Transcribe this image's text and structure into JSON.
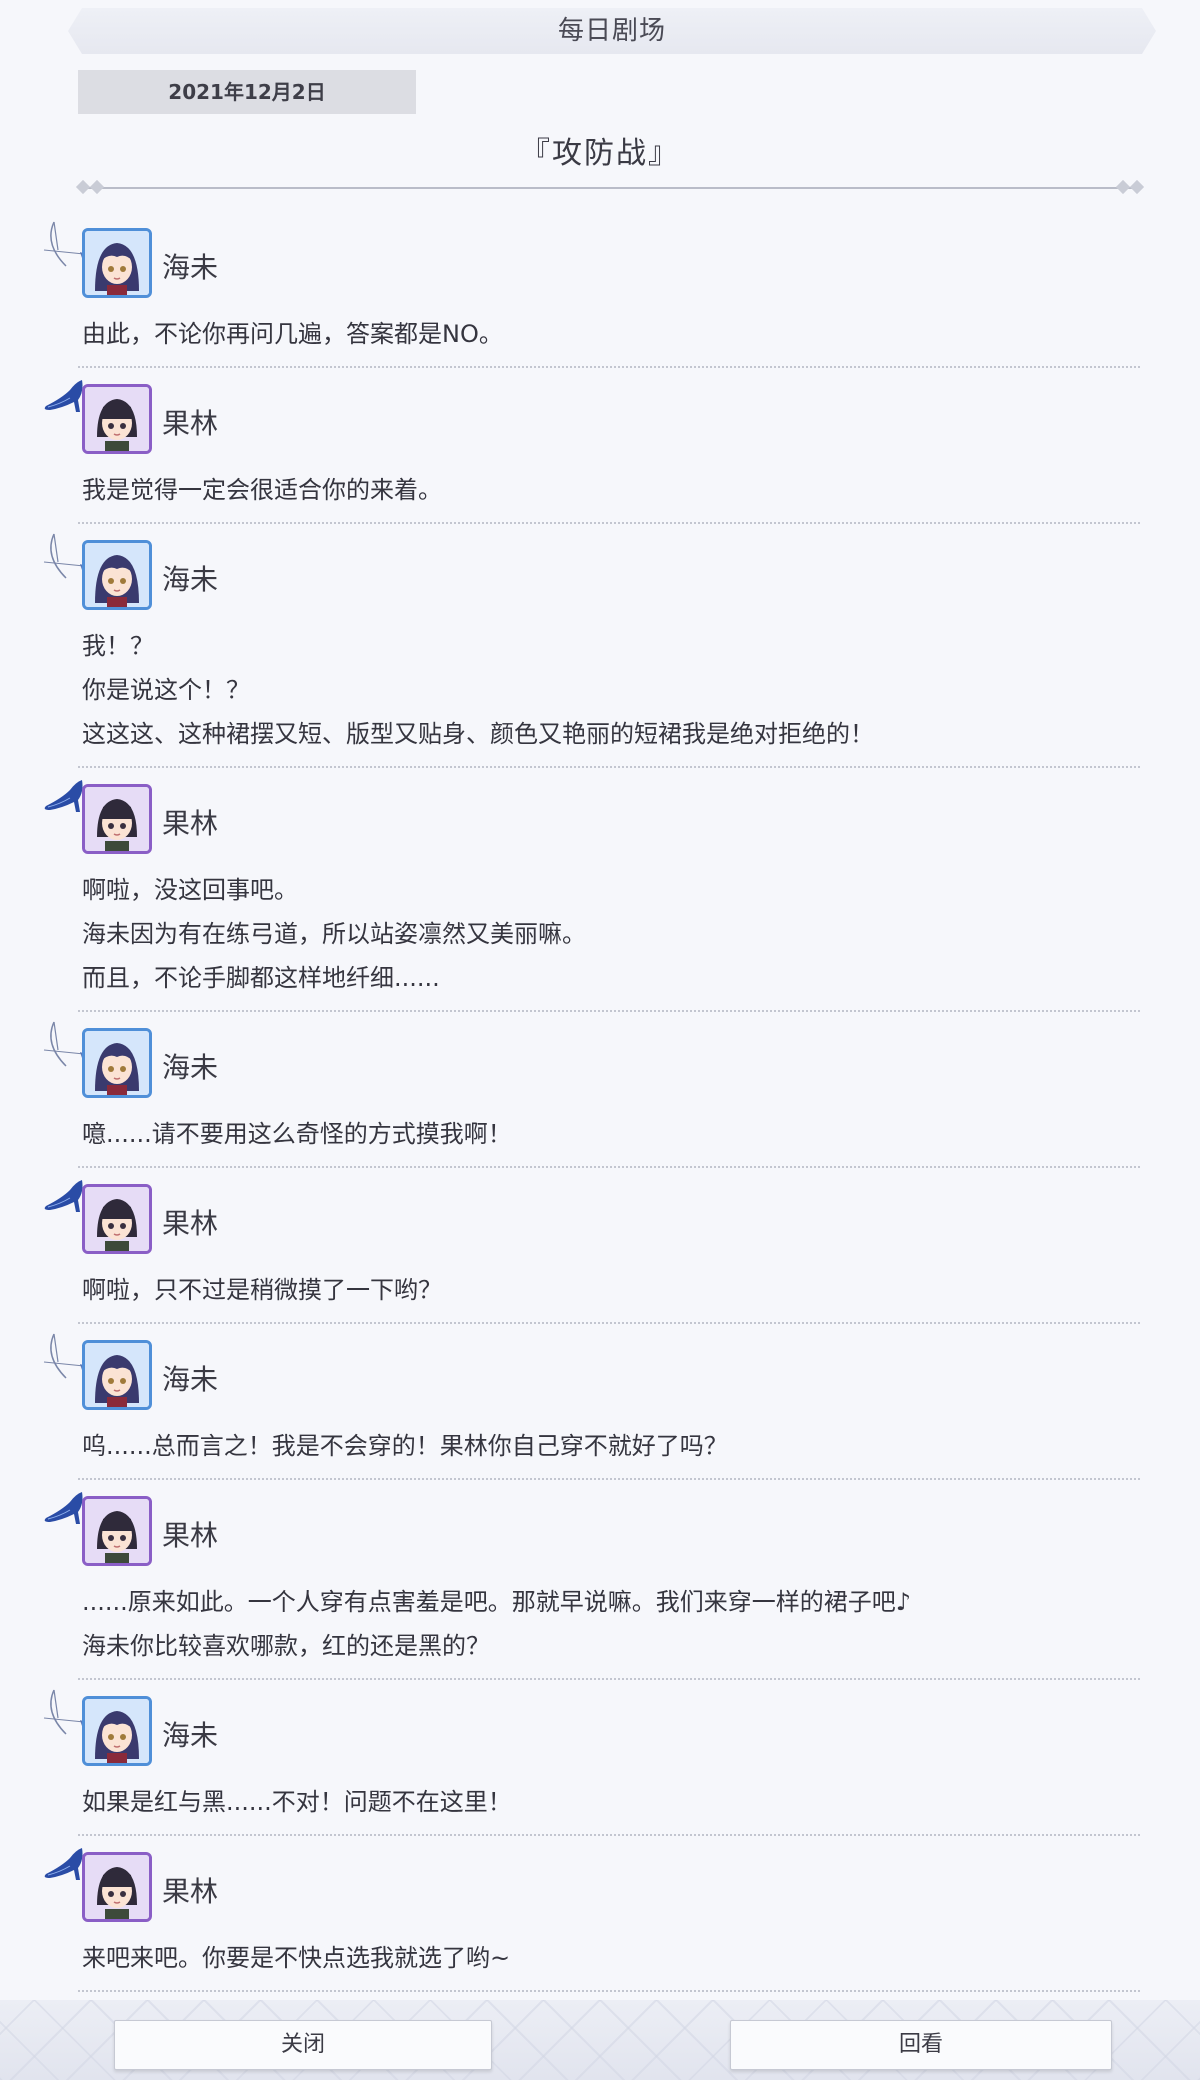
{
  "header": {
    "title": "每日剧场"
  },
  "date": "2021年12月2日",
  "episode_title": "『攻防战』",
  "characters": {
    "umi": {
      "name": "海未",
      "accent": "#4f8fd8"
    },
    "rin": {
      "name": "果林",
      "accent": "#8a5ec6"
    }
  },
  "dialogue": [
    {
      "speaker": "海未",
      "avatar": "umi",
      "lines": [
        "由此，不论你再问几遍，答案都是NO。"
      ]
    },
    {
      "speaker": "果林",
      "avatar": "rin",
      "lines": [
        "我是觉得一定会很适合你的来着。"
      ]
    },
    {
      "speaker": "海未",
      "avatar": "umi",
      "lines": [
        "我！？",
        "你是说这个！？",
        "这这这、这种裙摆又短、版型又贴身、颜色又艳丽的短裙我是绝对拒绝的！"
      ]
    },
    {
      "speaker": "果林",
      "avatar": "rin",
      "lines": [
        "啊啦，没这回事吧。",
        "海未因为有在练弓道，所以站姿凛然又美丽嘛。",
        "而且，不论手脚都这样地纤细......"
      ]
    },
    {
      "speaker": "海未",
      "avatar": "umi",
      "lines": [
        "噫......请不要用这么奇怪的方式摸我啊！"
      ]
    },
    {
      "speaker": "果林",
      "avatar": "rin",
      "lines": [
        "啊啦，只不过是稍微摸了一下哟？"
      ]
    },
    {
      "speaker": "海未",
      "avatar": "umi",
      "lines": [
        "呜......总而言之！我是不会穿的！果林你自己穿不就好了吗？"
      ]
    },
    {
      "speaker": "果林",
      "avatar": "rin",
      "lines": [
        "......原来如此。一个人穿有点害羞是吧。那就早说嘛。我们来穿一样的裙子吧♪",
        "海未你比较喜欢哪款，红的还是黑的？"
      ]
    },
    {
      "speaker": "海未",
      "avatar": "umi",
      "lines": [
        "如果是红与黑......不对！问题不在这里！"
      ]
    },
    {
      "speaker": "果林",
      "avatar": "rin",
      "lines": [
        "来吧来吧。你要是不快点选我就选了哟~"
      ]
    }
  ],
  "footer": {
    "close_label": "关闭",
    "replay_label": "回看"
  }
}
